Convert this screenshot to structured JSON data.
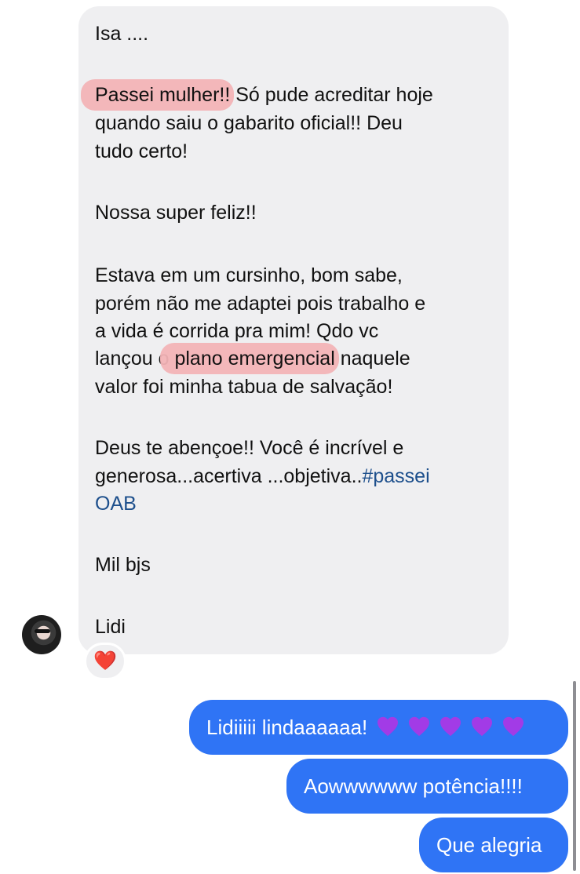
{
  "incoming": {
    "line_1": "Isa ....",
    "para1_highlight": "Passei mulher!!",
    "para1_rest": " Só pude acreditar hoje",
    "para1_line2": "quando saiu o gabarito oficial!! Deu",
    "para1_line3": "tudo certo!",
    "para2": "Nossa super feliz!!",
    "para3_line1": "Estava em um cursinho, bom sabe,",
    "para3_line2": "porém não me adaptei pois trabalho e",
    "para3_line3": "a vida é corrida pra mim! Qdo vc",
    "para3_line4_pre": "lançou o ",
    "para3_highlight": "plano emergencial",
    "para3_line4_post": " naquele",
    "para3_line5": "valor foi minha tabua de salvação!",
    "para4_line1": "Deus te abençoe!! Você é incrível e",
    "para4_line2_pre": "generosa...acertiva ...objetiva..",
    "hashtag_part1": "#passei",
    "hashtag_part2": "OAB",
    "para5": "Mil bjs",
    "signature": "Lidi",
    "reaction": "❤️"
  },
  "outgoing": [
    {
      "text": "Lidiiiii lindaaaaaa!",
      "hearts": 5,
      "heart_color": "#a23be6"
    },
    {
      "text": "Aowwwwww potência!!!!"
    },
    {
      "text": "Que alegria"
    }
  ],
  "colors": {
    "incoming_bubble": "#efeff1",
    "outgoing_bubble": "#2f74f5",
    "highlight": "#f2b3b6",
    "hashtag": "#1d4f8c"
  }
}
